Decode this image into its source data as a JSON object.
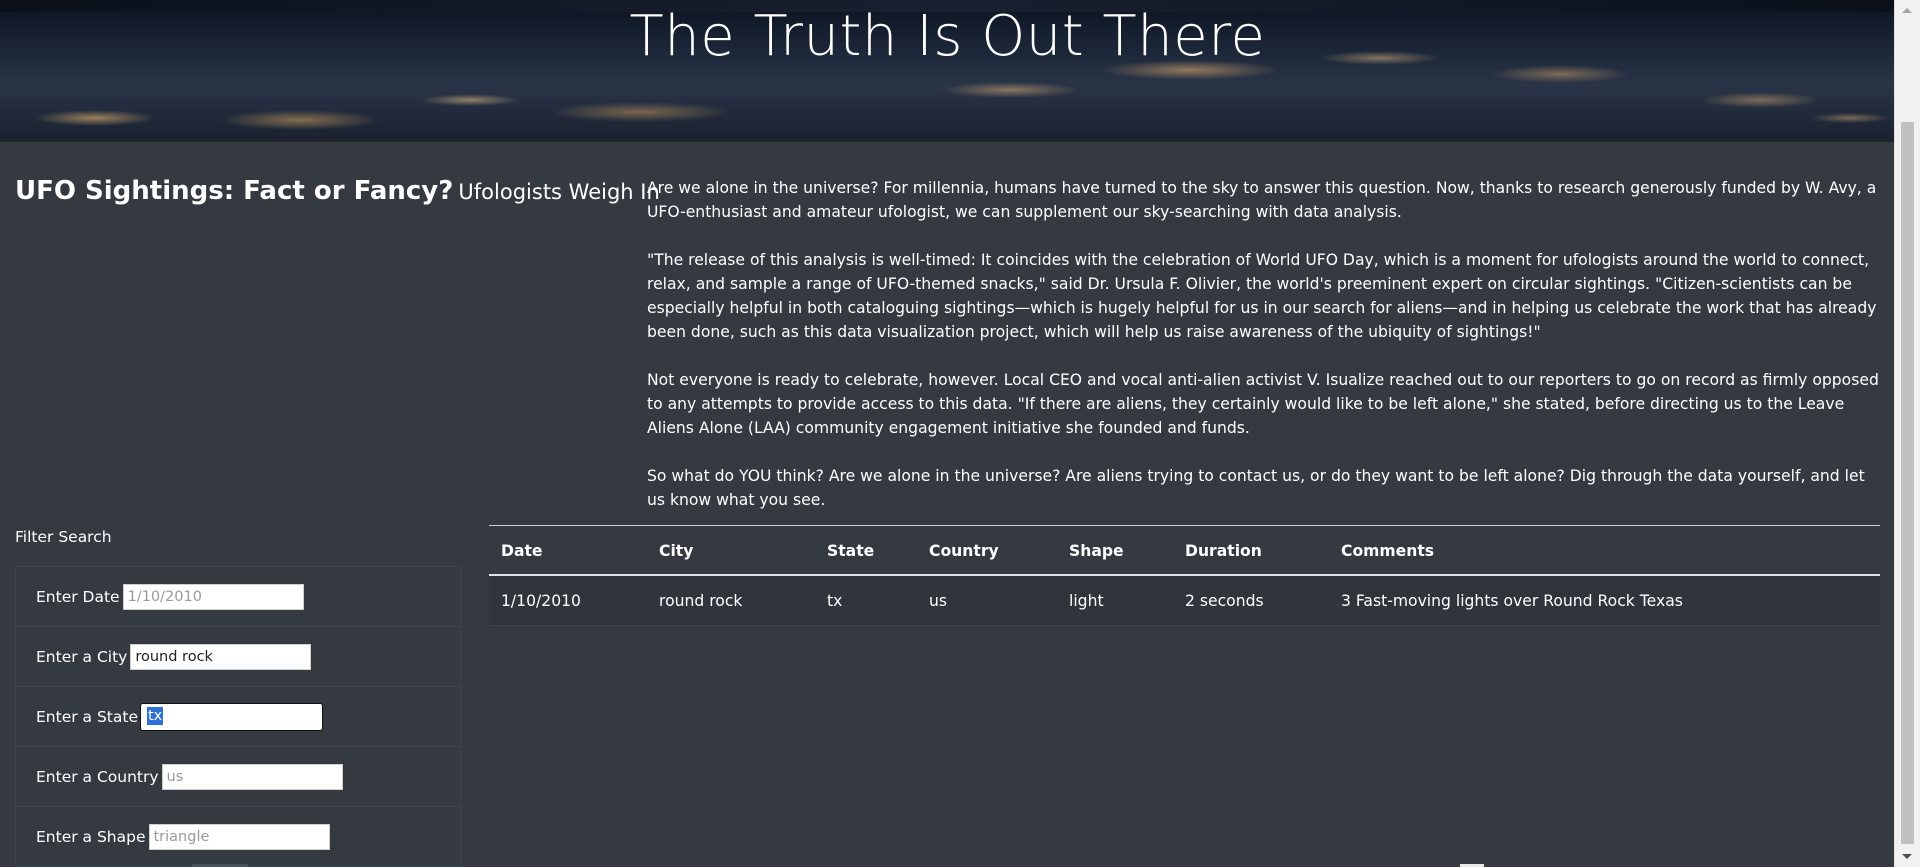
{
  "hero": {
    "title": "The Truth Is Out There"
  },
  "headline": {
    "main": "UFO Sightings: Fact or Fancy?",
    "sub": "Ufologists Weigh In"
  },
  "article": {
    "p1": "Are we alone in the universe? For millennia, humans have turned to the sky to answer this question. Now, thanks to research generously funded by W. Avy, a UFO-enthusiast and amateur ufologist, we can supplement our sky-searching with data analysis.",
    "p2": "\"The release of this analysis is well-timed: It coincides with the celebration of World UFO Day, which is a moment for ufologists around the world to connect, relax, and sample a range of UFO-themed snacks,\" said Dr. Ursula F. Olivier, the world's preeminent expert on circular sightings. \"Citizen-scientists can be especially helpful in both cataloguing sightings—which is hugely helpful for us in our search for aliens—and in helping us celebrate the work that has already been done, such as this data visualization project, which will help us raise awareness of the ubiquity of sightings!\"",
    "p3": "Not everyone is ready to celebrate, however. Local CEO and vocal anti-alien activist V. Isualize reached out to our reporters to go on record as firmly opposed to any attempts to provide access to this data. \"If there are aliens, they certainly would like to be left alone,\" she stated, before directing us to the Leave Aliens Alone (LAA) community engagement initiative she founded and funds.",
    "p4": "So what do YOU think? Are we alone in the universe? Are aliens trying to contact us, or do they want to be left alone? Dig through the data yourself, and let us know what you see."
  },
  "filter": {
    "title": "Filter Search",
    "date": {
      "label": "Enter Date",
      "value": "",
      "placeholder": "1/10/2010"
    },
    "city": {
      "label": "Enter a City",
      "value": "round rock",
      "placeholder": ""
    },
    "state": {
      "label": "Enter a State",
      "value": "tx",
      "placeholder": ""
    },
    "country": {
      "label": "Enter a Country",
      "value": "",
      "placeholder": "us"
    },
    "shape": {
      "label": "Enter a Shape",
      "value": "",
      "placeholder": "triangle"
    }
  },
  "table": {
    "headers": {
      "date": "Date",
      "city": "City",
      "state": "State",
      "country": "Country",
      "shape": "Shape",
      "duration": "Duration",
      "comments": "Comments"
    },
    "rows": [
      {
        "date": "1/10/2010",
        "city": "round rock",
        "state": "tx",
        "country": "us",
        "shape": "light",
        "duration": "2 seconds",
        "comments": "3 Fast-moving lights over Round Rock Texas"
      }
    ]
  },
  "colors": {
    "background": "#353a41",
    "selection": "#2f6fd6"
  }
}
